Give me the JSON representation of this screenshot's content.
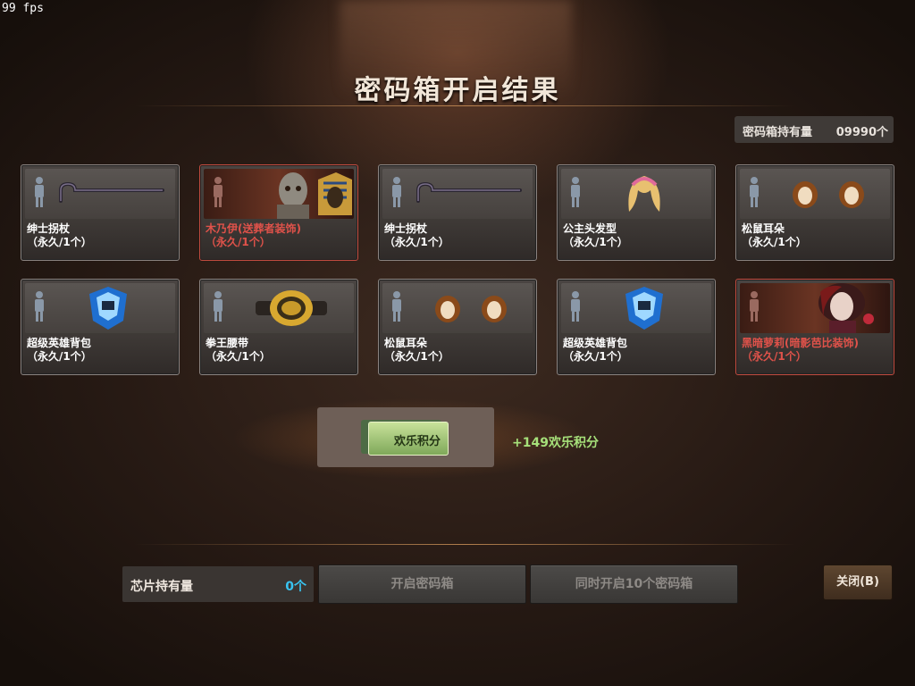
{
  "fps": "99 fps",
  "title": "密码箱开启结果",
  "holdings": {
    "label": "密码箱持有量",
    "count": "09990个"
  },
  "items": [
    {
      "name": "绅士拐杖",
      "duration": "（永久/1个）",
      "icon": "cane-icon",
      "rare": false
    },
    {
      "name": "木乃伊(送葬者装饰)",
      "duration": "（永久/1个）",
      "icon": "mummy-icon",
      "rare": true
    },
    {
      "name": "绅士拐杖",
      "duration": "（永久/1个）",
      "icon": "cane-icon",
      "rare": false
    },
    {
      "name": "公主头发型",
      "duration": "（永久/1个）",
      "icon": "princess-hair-icon",
      "rare": false
    },
    {
      "name": "松鼠耳朵",
      "duration": "（永久/1个）",
      "icon": "squirrel-ears-icon",
      "rare": false
    },
    {
      "name": "超级英雄背包",
      "duration": "（永久/1个）",
      "icon": "hero-backpack-icon",
      "rare": false
    },
    {
      "name": "拳王腰带",
      "duration": "（永久/1个）",
      "icon": "champion-belt-icon",
      "rare": false
    },
    {
      "name": "松鼠耳朵",
      "duration": "（永久/1个）",
      "icon": "squirrel-ears-icon",
      "rare": false
    },
    {
      "name": "超级英雄背包",
      "duration": "（永久/1个）",
      "icon": "hero-backpack-icon",
      "rare": false
    },
    {
      "name": "黑暗萝莉(暗影芭比装饰)",
      "duration": "（永久/1个）",
      "icon": "dark-lolita-icon",
      "rare": true
    }
  ],
  "reward": {
    "ticket_label": "欢乐积分",
    "text": "+149欢乐积分"
  },
  "chip": {
    "label": "芯片持有量",
    "count": "0个"
  },
  "buttons": {
    "open": "开启密码箱",
    "open10": "同时开启10个密码箱",
    "close": "关闭(B)"
  },
  "colors": {
    "rare": "#e0524a",
    "reward": "#a6e07a",
    "chip_count": "#38c3f0"
  }
}
